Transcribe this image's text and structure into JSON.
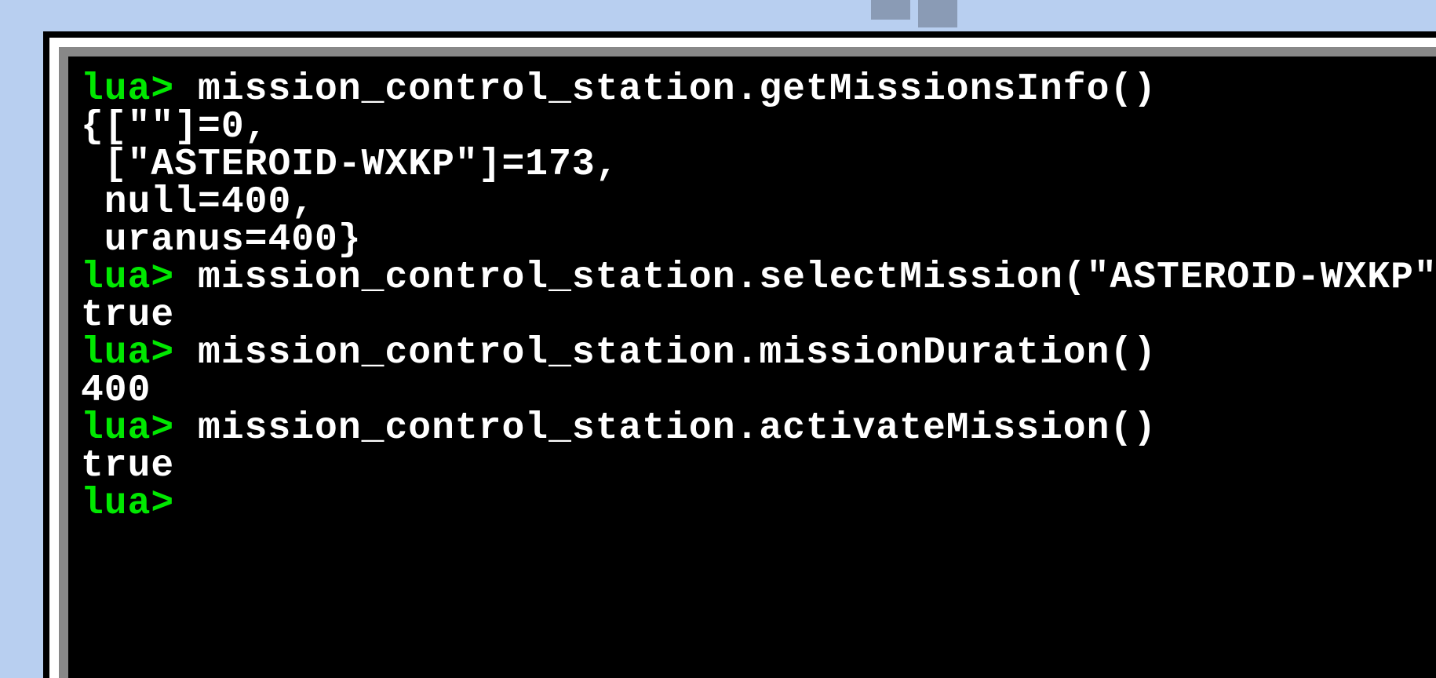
{
  "colors": {
    "background": "#b8cff0",
    "terminal_bg": "#000000",
    "prompt": "#00e800",
    "text": "#ffffff",
    "frame_outer": "#000000",
    "frame_white": "#ffffff",
    "frame_gray": "#888888"
  },
  "prompt_text": "lua>",
  "lines": [
    {
      "type": "command",
      "prompt": "lua>",
      "text": " mission_control_station.getMissionsInfo()"
    },
    {
      "type": "output",
      "text": "{[\"\"]=0,"
    },
    {
      "type": "output",
      "text": " [\"ASTEROID-WXKP\"]=173,"
    },
    {
      "type": "output",
      "text": " null=400,"
    },
    {
      "type": "output",
      "text": " uranus=400}"
    },
    {
      "type": "command",
      "prompt": "lua>",
      "text": " mission_control_station.selectMission(\"ASTEROID-WXKP\")"
    },
    {
      "type": "output",
      "text": "true"
    },
    {
      "type": "command",
      "prompt": "lua>",
      "text": " mission_control_station.missionDuration()"
    },
    {
      "type": "output",
      "text": "400"
    },
    {
      "type": "command",
      "prompt": "lua>",
      "text": " mission_control_station.activateMission()"
    },
    {
      "type": "output",
      "text": "true"
    },
    {
      "type": "prompt_only",
      "prompt": "lua>",
      "text": " "
    }
  ]
}
